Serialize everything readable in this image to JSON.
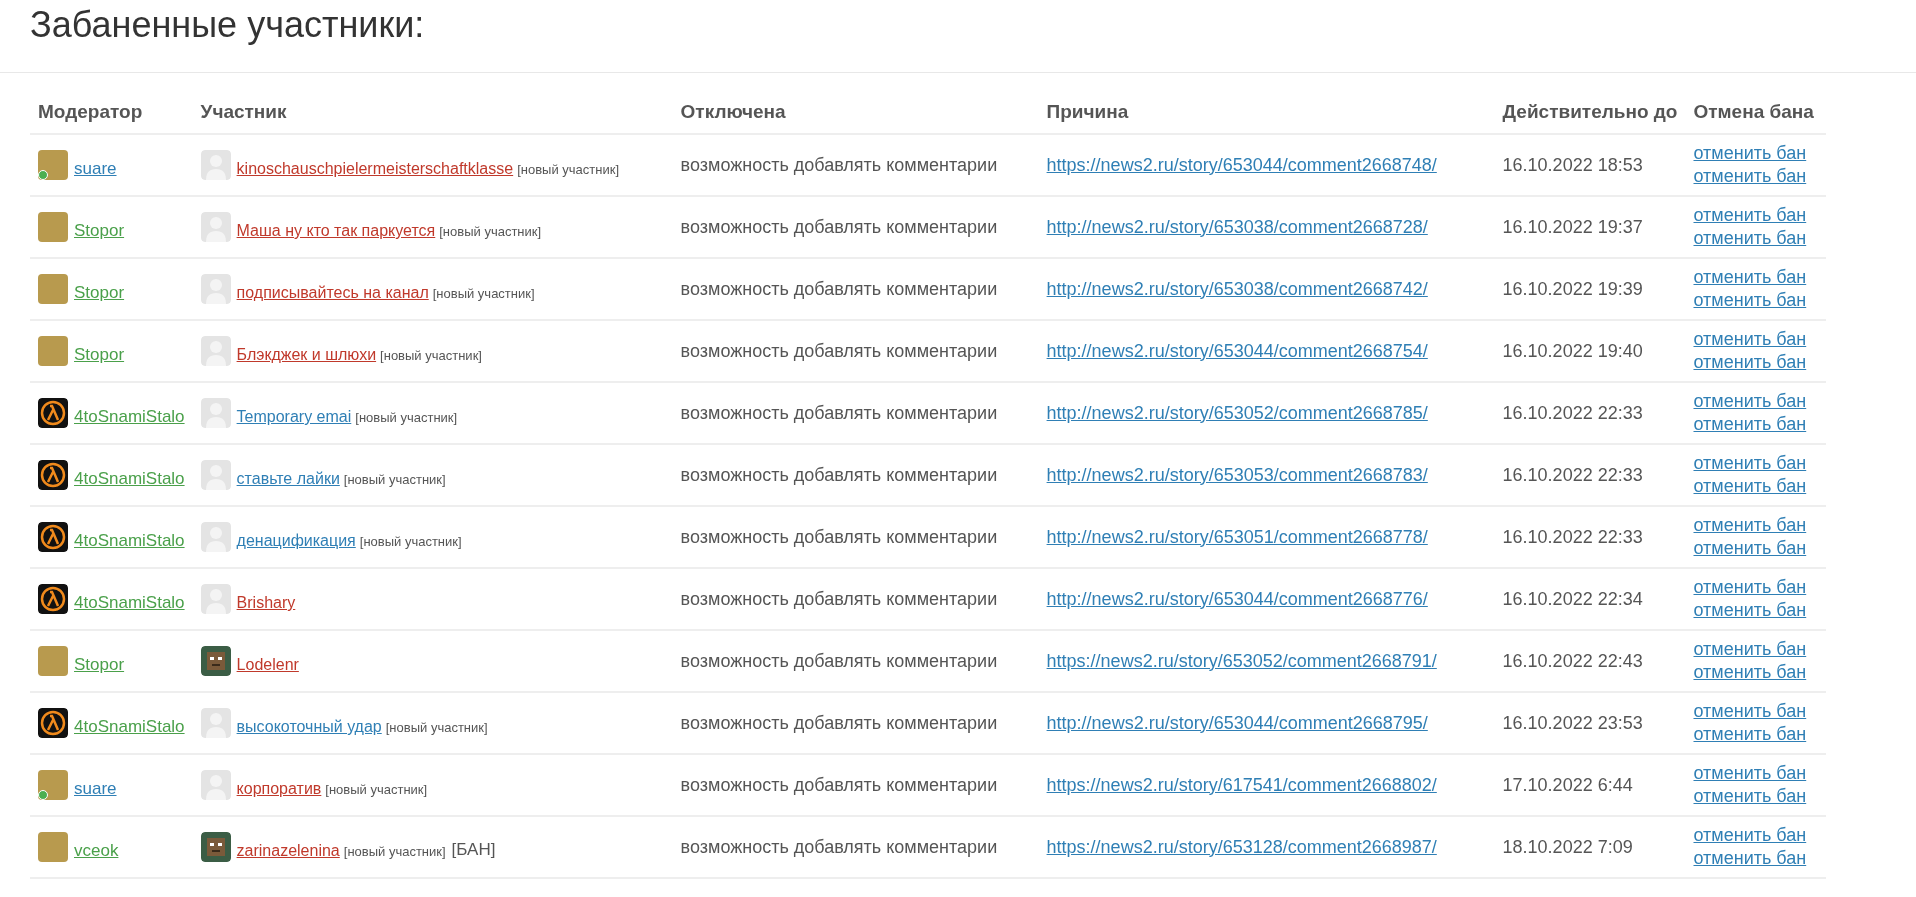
{
  "title": "Забаненные участники:",
  "table": {
    "columns": [
      "Модератор",
      "Участник",
      "Отключена",
      "Причина",
      "Действительно до",
      "Отмена бана"
    ],
    "rows": [
      {
        "moderator": {
          "name": "suare",
          "kind": "photo",
          "color": "#2f7fb5",
          "online": true
        },
        "member": {
          "name": "kinoschauschpielermeisterschaftklasse",
          "kind": "default",
          "color": "#c0392b",
          "tag": "[новый участник]"
        },
        "disabled": "возможность добавлять комментарии",
        "reason": "https://news2.ru/story/653044/comment2668748/",
        "until": "16.10.2022 18:53",
        "actions": [
          "отменить бан",
          "отменить бан"
        ]
      },
      {
        "moderator": {
          "name": "Stopor",
          "kind": "photo",
          "color": "#4aa04a",
          "online": false
        },
        "member": {
          "name": "Маша ну кто так паркуется",
          "kind": "default",
          "color": "#c0392b",
          "tag": "[новый участник]"
        },
        "disabled": "возможность добавлять комментарии",
        "reason": "http://news2.ru/story/653038/comment2668728/",
        "until": "16.10.2022 19:37",
        "actions": [
          "отменить бан",
          "отменить бан"
        ]
      },
      {
        "moderator": {
          "name": "Stopor",
          "kind": "photo",
          "color": "#4aa04a",
          "online": false
        },
        "member": {
          "name": "подписывайтесь на канал",
          "kind": "default",
          "color": "#c0392b",
          "tag": "[новый участник]"
        },
        "disabled": "возможность добавлять комментарии",
        "reason": "http://news2.ru/story/653038/comment2668742/",
        "until": "16.10.2022 19:39",
        "actions": [
          "отменить бан",
          "отменить бан"
        ]
      },
      {
        "moderator": {
          "name": "Stopor",
          "kind": "photo",
          "color": "#4aa04a",
          "online": false
        },
        "member": {
          "name": "Блэкджек и шлюхи",
          "kind": "default",
          "color": "#c0392b",
          "tag": "[новый участник]"
        },
        "disabled": "возможность добавлять комментарии",
        "reason": "http://news2.ru/story/653044/comment2668754/",
        "until": "16.10.2022 19:40",
        "actions": [
          "отменить бан",
          "отменить бан"
        ]
      },
      {
        "moderator": {
          "name": "4toSnamiStalo",
          "kind": "lambda",
          "color": "#4aa04a",
          "online": false
        },
        "member": {
          "name": "Temporary emai",
          "kind": "default",
          "color": "#2f7fb5",
          "tag": "[новый участник]"
        },
        "disabled": "возможность добавлять комментарии",
        "reason": "http://news2.ru/story/653052/comment2668785/",
        "until": "16.10.2022 22:33",
        "actions": [
          "отменить бан",
          "отменить бан"
        ]
      },
      {
        "moderator": {
          "name": "4toSnamiStalo",
          "kind": "lambda",
          "color": "#4aa04a",
          "online": false
        },
        "member": {
          "name": "ставьте лайки",
          "kind": "default",
          "color": "#2f7fb5",
          "tag": "[новый участник]"
        },
        "disabled": "возможность добавлять комментарии",
        "reason": "http://news2.ru/story/653053/comment2668783/",
        "until": "16.10.2022 22:33",
        "actions": [
          "отменить бан",
          "отменить бан"
        ]
      },
      {
        "moderator": {
          "name": "4toSnamiStalo",
          "kind": "lambda",
          "color": "#4aa04a",
          "online": false
        },
        "member": {
          "name": "денацификация",
          "kind": "default",
          "color": "#2f7fb5",
          "tag": "[новый участник]"
        },
        "disabled": "возможность добавлять комментарии",
        "reason": "http://news2.ru/story/653051/comment2668778/",
        "until": "16.10.2022 22:33",
        "actions": [
          "отменить бан",
          "отменить бан"
        ]
      },
      {
        "moderator": {
          "name": "4toSnamiStalo",
          "kind": "lambda",
          "color": "#4aa04a",
          "online": false
        },
        "member": {
          "name": "Brishary",
          "kind": "default",
          "color": "#c0392b"
        },
        "disabled": "возможность добавлять комментарии",
        "reason": "http://news2.ru/story/653044/comment2668776/",
        "until": "16.10.2022 22:34",
        "actions": [
          "отменить бан",
          "отменить бан"
        ]
      },
      {
        "moderator": {
          "name": "Stopor",
          "kind": "photo",
          "color": "#4aa04a",
          "online": false
        },
        "member": {
          "name": "Lodelenr",
          "kind": "pixel",
          "color": "#c0392b"
        },
        "disabled": "возможность добавлять комментарии",
        "reason": "https://news2.ru/story/653052/comment2668791/",
        "until": "16.10.2022 22:43",
        "actions": [
          "отменить бан",
          "отменить бан"
        ]
      },
      {
        "moderator": {
          "name": "4toSnamiStalo",
          "kind": "lambda",
          "color": "#4aa04a",
          "online": false
        },
        "member": {
          "name": "высокоточный удар",
          "kind": "default",
          "color": "#2f7fb5",
          "tag": "[новый участник]"
        },
        "disabled": "возможность добавлять комментарии",
        "reason": "http://news2.ru/story/653044/comment2668795/",
        "until": "16.10.2022 23:53",
        "actions": [
          "отменить бан",
          "отменить бан"
        ]
      },
      {
        "moderator": {
          "name": "suare",
          "kind": "photo",
          "color": "#2f7fb5",
          "online": true
        },
        "member": {
          "name": "корпоратив",
          "kind": "default",
          "color": "#c0392b",
          "tag": "[новый участник]"
        },
        "disabled": "возможность добавлять комментарии",
        "reason": "https://news2.ru/story/617541/comment2668802/",
        "until": "17.10.2022 6:44",
        "actions": [
          "отменить бан",
          "отменить бан"
        ]
      },
      {
        "moderator": {
          "name": "vceok",
          "kind": "photo",
          "color": "#4aa04a",
          "online": false
        },
        "member": {
          "name": "zarinazelenina",
          "kind": "pixel",
          "color": "#c0392b",
          "tag": "[новый участник]",
          "ban": "[БАН]"
        },
        "disabled": "возможность добавлять комментарии",
        "reason": "https://news2.ru/story/653128/comment2668987/",
        "until": "18.10.2022 7:09",
        "actions": [
          "отменить бан",
          "отменить бан"
        ]
      }
    ]
  }
}
